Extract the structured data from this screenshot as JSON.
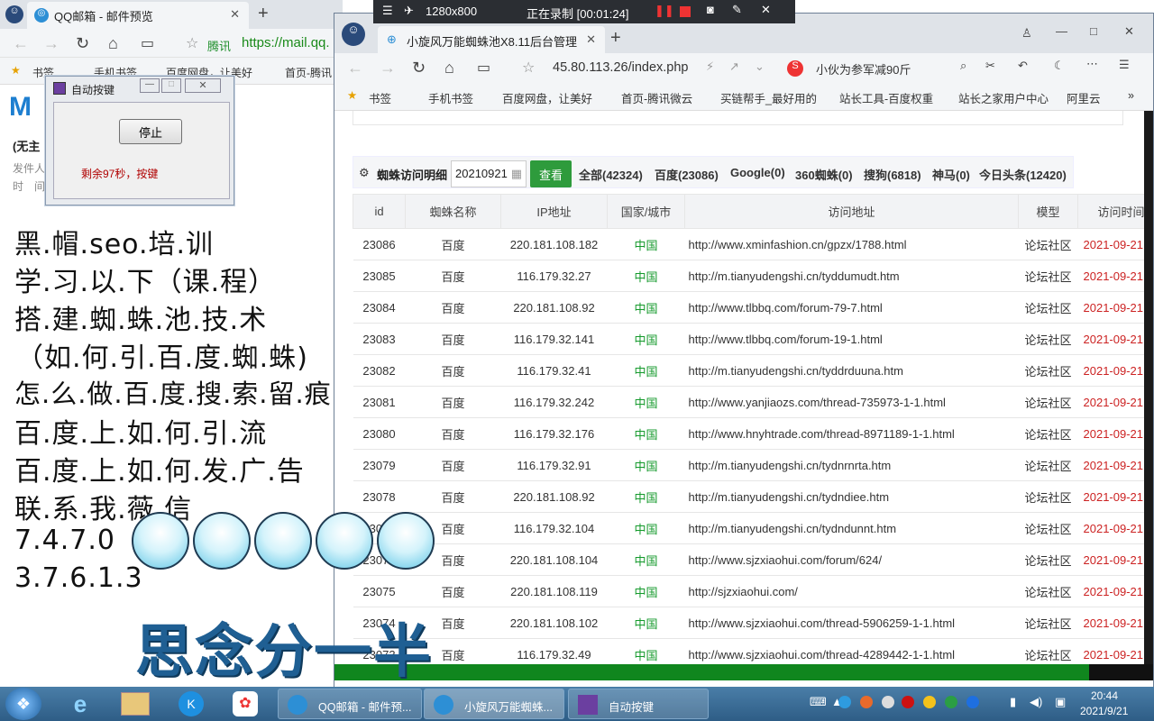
{
  "back_browser": {
    "tab_title": "QQ邮箱 - 邮件预览",
    "url_site": "腾讯",
    "url": "https://mail.qq.",
    "bookmarks": [
      "书签",
      "手机书签",
      "百度网盘，让美好",
      "首页-腾讯"
    ],
    "mail_subject": "(无主",
    "sender_label": "发件人",
    "time_label": "时　间"
  },
  "dialog": {
    "title": "自动按键",
    "stop_label": "停止",
    "status": "剩余97秒，按键"
  },
  "promo": {
    "lines": [
      "黑.帽.seo.培.训",
      "学.习.以.下（课.程）",
      "搭.建.蜘.蛛.池.技.术",
      "（如.何.引.百.度.蜘.蛛)",
      "怎.么.做.百.度.搜.索.留.痕",
      "百.度.上.如.何.引.流",
      "百.度.上.如.何.发.广.告",
      "联.系.我.薇.信",
      "7.4.7.0",
      "3.7.6.1.3"
    ],
    "big": "思念分一半"
  },
  "recorder": {
    "resolution": "1280x800",
    "status": "正在录制 [00:01:24]"
  },
  "main_browser": {
    "tab_title": "小旋风万能蜘蛛池X8.11后台管理",
    "url": "45.80.113.26/index.php",
    "search_text": "小伙为参军减90斤",
    "bookmarks": [
      "书签",
      "手机书签",
      "百度网盘，让美好",
      "首页-腾讯微云",
      "买链帮手_最好用的",
      "站长工具-百度权重",
      "站长之家用户中心",
      "阿里云"
    ]
  },
  "filter": {
    "label": "蜘蛛访问明细",
    "date": "20210921",
    "view_label": "查看",
    "stats": [
      "全部(42324)",
      "百度(23086)",
      "Google(0)",
      "360蜘蛛(0)",
      "搜狗(6818)",
      "神马(0)",
      "今日头条(12420)"
    ]
  },
  "table": {
    "headers": [
      "id",
      "蜘蛛名称",
      "IP地址",
      "国家/城市",
      "访问地址",
      "模型",
      "访问时间"
    ],
    "rows": [
      [
        "23086",
        "百度",
        "220.181.108.182",
        "中国",
        "http://www.xminfashion.cn/gpzx/1788.html",
        "论坛社区",
        "2021-09-21"
      ],
      [
        "23085",
        "百度",
        "116.179.32.27",
        "中国",
        "http://m.tianyudengshi.cn/tyddumudt.htm",
        "论坛社区",
        "2021-09-21"
      ],
      [
        "23084",
        "百度",
        "220.181.108.92",
        "中国",
        "http://www.tlbbq.com/forum-79-7.html",
        "论坛社区",
        "2021-09-21"
      ],
      [
        "23083",
        "百度",
        "116.179.32.141",
        "中国",
        "http://www.tlbbq.com/forum-19-1.html",
        "论坛社区",
        "2021-09-21"
      ],
      [
        "23082",
        "百度",
        "116.179.32.41",
        "中国",
        "http://m.tianyudengshi.cn/tyddrduuna.htm",
        "论坛社区",
        "2021-09-21"
      ],
      [
        "23081",
        "百度",
        "116.179.32.242",
        "中国",
        "http://www.yanjiaozs.com/thread-735973-1-1.html",
        "论坛社区",
        "2021-09-21"
      ],
      [
        "23080",
        "百度",
        "116.179.32.176",
        "中国",
        "http://www.hnyhtrade.com/thread-8971189-1-1.html",
        "论坛社区",
        "2021-09-21"
      ],
      [
        "23079",
        "百度",
        "116.179.32.91",
        "中国",
        "http://m.tianyudengshi.cn/tydnrnrta.htm",
        "论坛社区",
        "2021-09-21"
      ],
      [
        "23078",
        "百度",
        "220.181.108.92",
        "中国",
        "http://m.tianyudengshi.cn/tydndiee.htm",
        "论坛社区",
        "2021-09-21"
      ],
      [
        "23077",
        "百度",
        "116.179.32.104",
        "中国",
        "http://m.tianyudengshi.cn/tydndunnt.htm",
        "论坛社区",
        "2021-09-21"
      ],
      [
        "23076",
        "百度",
        "220.181.108.104",
        "中国",
        "http://www.sjzxiaohui.com/forum/624/",
        "论坛社区",
        "2021-09-21"
      ],
      [
        "23075",
        "百度",
        "220.181.108.119",
        "中国",
        "http://sjzxiaohui.com/",
        "论坛社区",
        "2021-09-21"
      ],
      [
        "23074",
        "百度",
        "220.181.108.102",
        "中国",
        "http://www.sjzxiaohui.com/thread-5906259-1-1.html",
        "论坛社区",
        "2021-09-21"
      ],
      [
        "23073",
        "百度",
        "116.179.32.49",
        "中国",
        "http://www.sjzxiaohui.com/thread-4289442-1-1.html",
        "论坛社区",
        "2021-09-21"
      ]
    ]
  },
  "progress": 0.922,
  "taskbar": {
    "items": [
      "QQ邮箱 - 邮件预...",
      "小旋风万能蜘蛛...",
      "自动按键"
    ],
    "time": "20:44",
    "date": "2021/9/21"
  },
  "colors": {
    "accent_green": "#2e9b3c",
    "date_red": "#cc2222",
    "country_green": "#159a2c"
  }
}
